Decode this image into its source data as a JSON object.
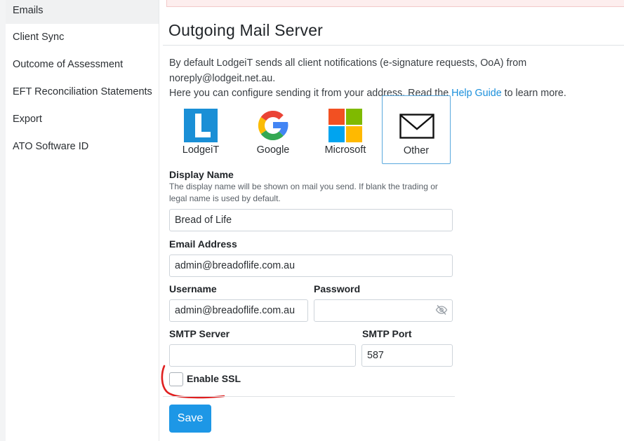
{
  "sidebar": {
    "items": [
      {
        "label": "Emails",
        "active": true
      },
      {
        "label": "Client Sync"
      },
      {
        "label": "Outcome of Assessment"
      },
      {
        "label": "EFT Reconciliation Statements"
      },
      {
        "label": "Export"
      },
      {
        "label": "ATO Software ID"
      }
    ]
  },
  "main": {
    "title": "Outgoing Mail Server",
    "intro_line1": "By default LodgeiT sends all client notifications (e-signature requests, OoA) from noreply@lodgeit.net.au.",
    "intro_line2_pre": "Here you can configure sending it from your address. Read the ",
    "help_link": "Help Guide",
    "intro_line2_post": " to learn more.",
    "providers": [
      {
        "label": "LodgeiT",
        "icon": "lodgeit-logo-icon"
      },
      {
        "label": "Google",
        "icon": "google-logo-icon"
      },
      {
        "label": "Microsoft",
        "icon": "microsoft-logo-icon"
      },
      {
        "label": "Other",
        "icon": "envelope-icon",
        "selected": true
      }
    ],
    "display_name_label": "Display Name",
    "display_name_help": "The display name will be shown on mail you send. If blank the trading or legal name is used by default.",
    "display_name_value": "Bread of Life",
    "email_label": "Email Address",
    "email_value": "admin@breadoflife.com.au",
    "username_label": "Username",
    "username_value": "admin@breadoflife.com.au",
    "password_label": "Password",
    "password_value": "",
    "smtp_server_label": "SMTP Server",
    "smtp_server_value": "",
    "smtp_port_label": "SMTP Port",
    "smtp_port_value": "587",
    "ssl_label": "Enable SSL",
    "ssl_checked": false,
    "save_label": "Save"
  },
  "colors": {
    "accent": "#1d97e6",
    "link": "#1a8fdb",
    "selected_border": "#5aa9de",
    "annotation": "#e02020"
  }
}
